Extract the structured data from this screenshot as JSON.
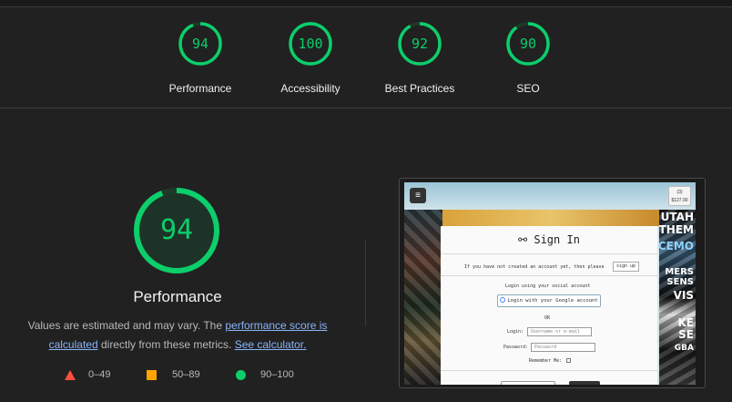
{
  "colors": {
    "pass": "#0cce6b",
    "average": "#ffa400",
    "fail": "#ff4e42",
    "background": "#212121"
  },
  "summary": [
    {
      "score": "94",
      "label": "Performance",
      "fraction": 0.94
    },
    {
      "score": "100",
      "label": "Accessibility",
      "fraction": 1.0
    },
    {
      "score": "92",
      "label": "Best Practices",
      "fraction": 0.92
    },
    {
      "score": "90",
      "label": "SEO",
      "fraction": 0.9
    }
  ],
  "performance": {
    "score": "94",
    "fraction": 0.94,
    "title": "Performance",
    "desc_prefix": "Values are estimated and may vary. The ",
    "link_score": "performance score is calculated",
    "desc_mid": " directly from these metrics. ",
    "link_calc": "See calculator."
  },
  "legend": [
    {
      "icon": "triangle-icon",
      "range": "0–49"
    },
    {
      "icon": "square-icon",
      "range": "50–89"
    },
    {
      "icon": "circle-icon",
      "range": "90–100"
    }
  ],
  "screenshot": {
    "menu_icon": "≡",
    "cart_count": "(3)",
    "cart_total": "$127.90",
    "collage_text": [
      "UTAH",
      "THEM",
      "CEMO",
      "MERS",
      "SENS",
      "VIS",
      "KE",
      "SE",
      "GBA"
    ],
    "title": "Sign In",
    "not_created": "If you have not created an account yet, then please",
    "sign_up": "sign up",
    "social_prompt": "Login using your social account",
    "google_btn": "Login with your Google account",
    "or": "OR",
    "login_label": "Login:",
    "login_placeholder": "Username or e-mail",
    "password_label": "Password:",
    "password_placeholder": "Password",
    "remember_label": "Remember Me:"
  }
}
